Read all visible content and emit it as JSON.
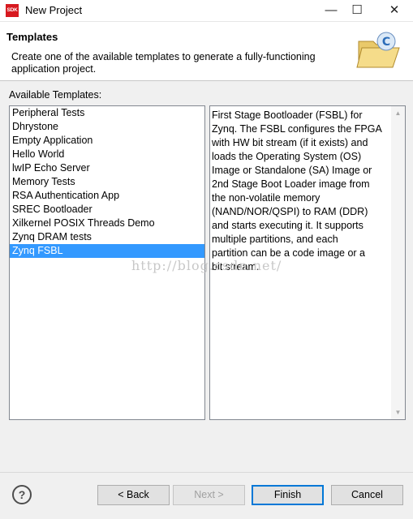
{
  "window": {
    "app_icon_text": "SDK",
    "title": "New Project",
    "minimize": "—",
    "maximize": "☐",
    "close": "✕"
  },
  "header": {
    "title": "Templates",
    "description": "Create one of the available templates to generate a fully-functioning application project."
  },
  "templates": {
    "label": "Available Templates:",
    "items": [
      "Peripheral Tests",
      "Dhrystone",
      "Empty Application",
      "Hello World",
      "lwIP Echo Server",
      "Memory Tests",
      "RSA Authentication App",
      "SREC Bootloader",
      "Xilkernel POSIX Threads Demo",
      "Zynq DRAM tests",
      "Zynq FSBL"
    ],
    "selected": "Zynq FSBL"
  },
  "description": {
    "text": "First Stage Bootloader (FSBL) for\nZynq. The FSBL configures the FPGA\nwith HW bit stream (if it exists)  and\nloads the Operating System (OS)\nImage or Standalone (SA) Image or\n2nd Stage Boot Loader image from\nthe  non-volatile memory\n(NAND/NOR/QSPI) to RAM (DDR)\nand starts executing it.  It supports\nmultiple partitions,  and each\npartition can be a code image or a\nbit stream."
  },
  "watermark": "http://blog.csdn.net/",
  "buttons": {
    "help": "?",
    "back": "< Back",
    "next": "Next >",
    "finish": "Finish",
    "cancel": "Cancel"
  },
  "colors": {
    "selection": "#3399ff",
    "app_icon": "#d7191f"
  }
}
